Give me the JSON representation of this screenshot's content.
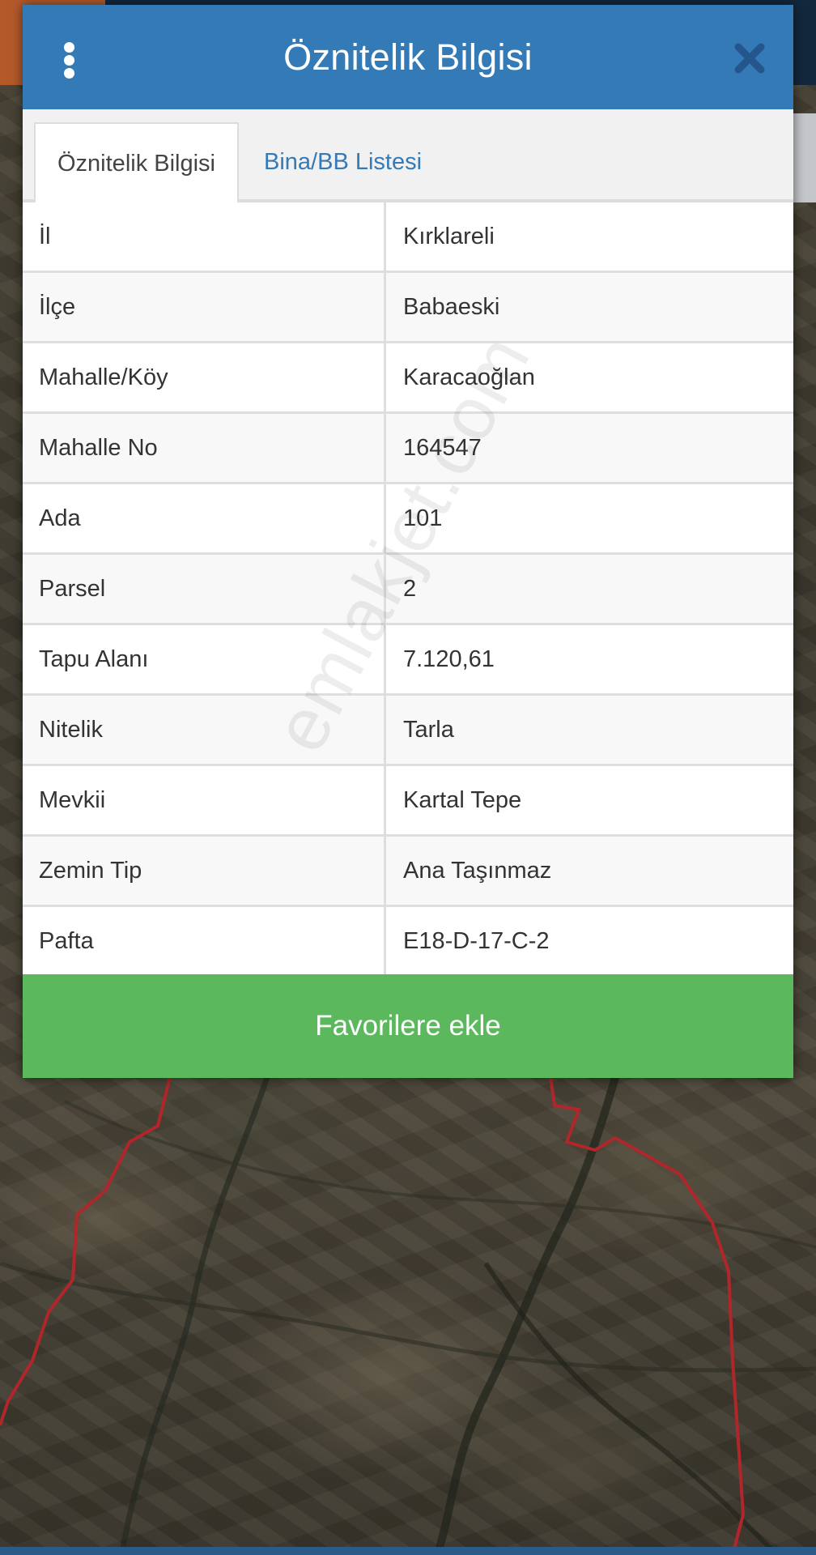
{
  "header": {
    "title": "Öznitelik Bilgisi",
    "menu_icon": "kebab-menu-icon",
    "close_icon": "close-icon"
  },
  "tabs": [
    {
      "label": "Öznitelik Bilgisi",
      "active": true
    },
    {
      "label": "Bina/BB Listesi",
      "active": false
    }
  ],
  "attributes": [
    {
      "label": "İl",
      "value": "Kırklareli"
    },
    {
      "label": "İlçe",
      "value": "Babaeski"
    },
    {
      "label": "Mahalle/Köy",
      "value": "Karacaoğlan"
    },
    {
      "label": "Mahalle No",
      "value": "164547"
    },
    {
      "label": "Ada",
      "value": "101"
    },
    {
      "label": "Parsel",
      "value": "2"
    },
    {
      "label": "Tapu Alanı",
      "value": "7.120,61"
    },
    {
      "label": "Nitelik",
      "value": "Tarla"
    },
    {
      "label": "Mevkii",
      "value": "Kartal Tepe"
    },
    {
      "label": "Zemin Tip",
      "value": "Ana Taşınmaz"
    },
    {
      "label": "Pafta",
      "value": "E18-D-17-C-2"
    }
  ],
  "actions": {
    "favorite_label": "Favorilere ekle"
  },
  "watermark": "emlakjet.com",
  "colors": {
    "header_bg": "#337ab7",
    "favorite_bg": "#5cb85c",
    "parcel_outline": "#b0262a"
  }
}
